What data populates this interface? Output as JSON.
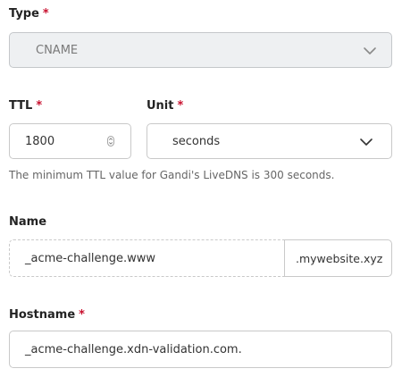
{
  "type_field": {
    "label": "Type",
    "required_mark": "*",
    "value": "CNAME",
    "disabled": true,
    "icon": "chevron-down-icon"
  },
  "ttl_field": {
    "label": "TTL",
    "required_mark": "*",
    "value": "1800",
    "icon": "number-stepper-icon"
  },
  "unit_field": {
    "label": "Unit",
    "required_mark": "*",
    "value": "seconds",
    "icon": "chevron-down-icon"
  },
  "ttl_helper_text": "The minimum TTL value for Gandi's LiveDNS is 300 seconds.",
  "name_field": {
    "label": "Name",
    "value": "_acme-challenge.www",
    "suffix": ".mywebsite.xyz"
  },
  "hostname_field": {
    "label": "Hostname",
    "required_mark": "*",
    "value": "_acme-challenge.xdn-validation.com."
  },
  "colors": {
    "required": "#c8102e",
    "border": "#c9c9c9",
    "disabled_bg": "#eef0f2",
    "helper_text": "#666666"
  }
}
